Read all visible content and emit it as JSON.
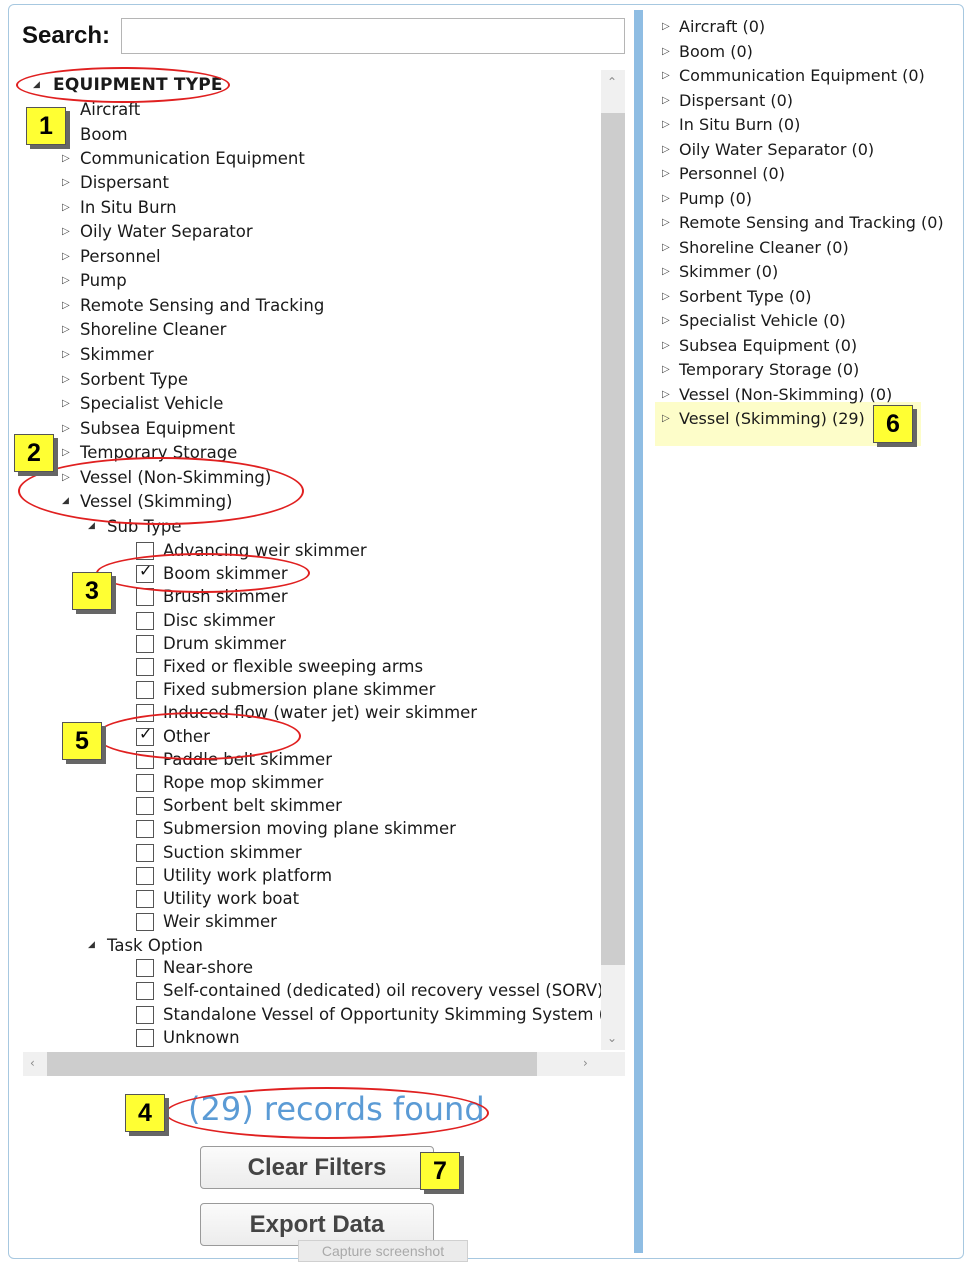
{
  "search": {
    "label": "Search:",
    "value": ""
  },
  "tree": {
    "root_label": "EQUIPMENT TYPE",
    "categories": [
      "Aircraft",
      "Boom",
      "Communication Equipment",
      "Dispersant",
      "In Situ Burn",
      "Oily Water Separator",
      "Personnel",
      "Pump",
      "Remote Sensing and Tracking",
      "Shoreline Cleaner",
      "Skimmer",
      "Sorbent Type",
      "Specialist Vehicle",
      "Subsea Equipment",
      "Temporary Storage",
      "Vessel (Non-Skimming)",
      "Vessel (Skimming)"
    ],
    "sub_type_label": "Sub Type",
    "sub_types": [
      {
        "label": "Advancing weir skimmer",
        "checked": false
      },
      {
        "label": "Boom skimmer",
        "checked": true
      },
      {
        "label": "Brush skimmer",
        "checked": false
      },
      {
        "label": "Disc skimmer",
        "checked": false
      },
      {
        "label": "Drum skimmer",
        "checked": false
      },
      {
        "label": "Fixed or flexible sweeping arms",
        "checked": false
      },
      {
        "label": "Fixed submersion plane skimmer",
        "checked": false
      },
      {
        "label": "Induced flow (water jet) weir skimmer",
        "checked": false
      },
      {
        "label": "Other",
        "checked": true
      },
      {
        "label": "Paddle belt skimmer",
        "checked": false
      },
      {
        "label": "Rope mop skimmer",
        "checked": false
      },
      {
        "label": "Sorbent belt skimmer",
        "checked": false
      },
      {
        "label": "Submersion moving plane skimmer",
        "checked": false
      },
      {
        "label": "Suction skimmer",
        "checked": false
      },
      {
        "label": "Utility work platform",
        "checked": false
      },
      {
        "label": "Utility work boat",
        "checked": false
      },
      {
        "label": "Weir skimmer",
        "checked": false
      }
    ],
    "task_option_label": "Task Option",
    "task_options": [
      {
        "label": "Near-shore",
        "checked": false
      },
      {
        "label": "Self-contained (dedicated) oil recovery vessel (SORV)",
        "checked": false
      },
      {
        "label": "Standalone Vessel of Opportunity Skimming System (V",
        "checked": false
      },
      {
        "label": "Unknown",
        "checked": false
      }
    ]
  },
  "status": {
    "records_found": "(29) records found"
  },
  "buttons": {
    "clear_filters": "Clear Filters",
    "export_data": "Export Data",
    "capture_screenshot": "Capture screenshot"
  },
  "results": {
    "items": [
      "Aircraft (0)",
      "Boom (0)",
      "Communication Equipment (0)",
      "Dispersant (0)",
      "In Situ Burn (0)",
      "Oily Water Separator (0)",
      "Personnel (0)",
      "Pump (0)",
      "Remote Sensing and Tracking (0)",
      "Shoreline Cleaner (0)",
      "Skimmer (0)",
      "Sorbent Type (0)",
      "Specialist Vehicle (0)",
      "Subsea Equipment (0)",
      "Temporary Storage (0)",
      "Vessel (Non-Skimming) (0)",
      "Vessel (Skimming) (29)"
    ],
    "highlighted_index": 16
  },
  "annotations": [
    "1",
    "2",
    "3",
    "4",
    "5",
    "6",
    "7"
  ],
  "colors": {
    "accent_blue": "#5b9bd5",
    "badge_yellow": "#ffff33",
    "annotation_red": "#e02020",
    "highlight": "#fdfdc9"
  }
}
